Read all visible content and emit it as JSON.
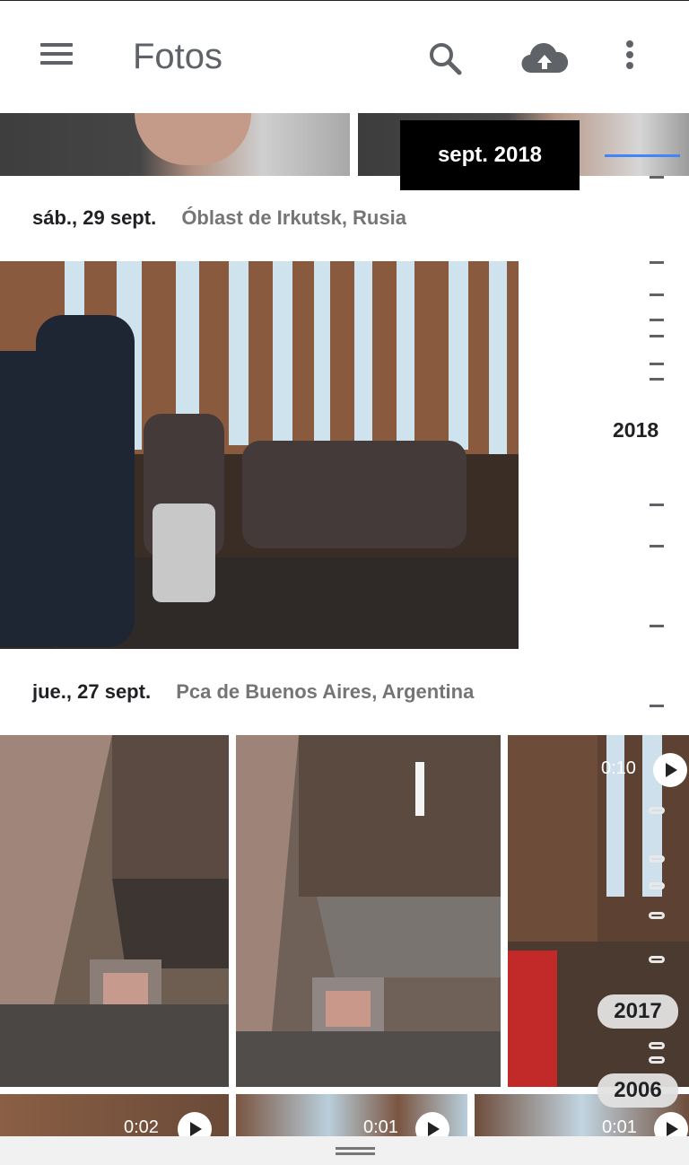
{
  "app": {
    "title": "Fotos"
  },
  "toolbar": {
    "menu_icon": "menu-icon",
    "search_icon": "search-icon",
    "upload_icon": "cloud-upload-icon",
    "more_icon": "more-vert-icon"
  },
  "scrubber": {
    "tooltip": "sept. 2018",
    "year_current": "2018",
    "years": [
      "2017",
      "2006"
    ],
    "accent": "#4285f4"
  },
  "sections": [
    {
      "date": "sáb., 29 sept.",
      "place": "Óblast de Irkutsk, Rusia"
    },
    {
      "date": "jue., 27 sept.",
      "place": "Pca de Buenos Aires, Argentina"
    }
  ],
  "videos": [
    {
      "duration": "0:10"
    },
    {
      "duration": "0:02"
    },
    {
      "duration": "0:01"
    },
    {
      "duration": "0:01"
    }
  ]
}
